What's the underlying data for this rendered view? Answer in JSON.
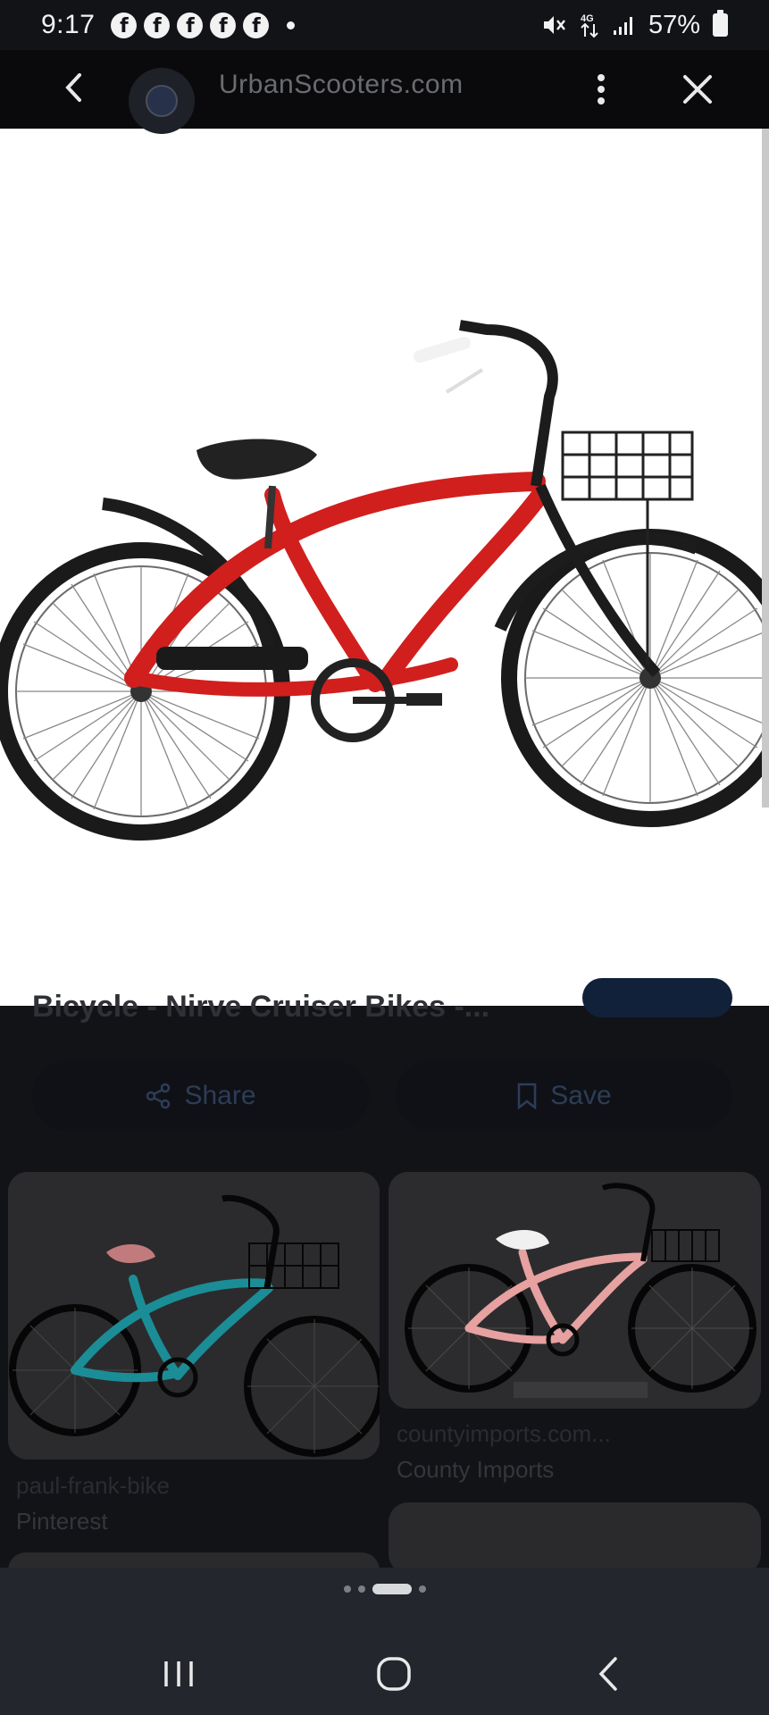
{
  "status_bar": {
    "time": "9:17",
    "notification_icons": [
      "facebook-icon",
      "facebook-icon",
      "facebook-icon",
      "facebook-icon",
      "facebook-icon"
    ],
    "fb_glyph": "f",
    "battery": "57%"
  },
  "browser": {
    "site_url": "UrbanScooters.com"
  },
  "result": {
    "title_fragment": "Bicycle - Nirve Cruiser Bikes -...",
    "share_label": "Share",
    "save_label": "Save"
  },
  "related": [
    {
      "caption": "paul-frank-bike",
      "source": "Pinterest",
      "bike_color": "#1b8d97"
    },
    {
      "caption": "countyimports.com...",
      "source": "County Imports",
      "bike_color": "#e6a1a0"
    }
  ],
  "colors": {
    "hero_bike_frame": "#d11f1d",
    "background": "#121317",
    "action_text": "#2d3d57"
  }
}
